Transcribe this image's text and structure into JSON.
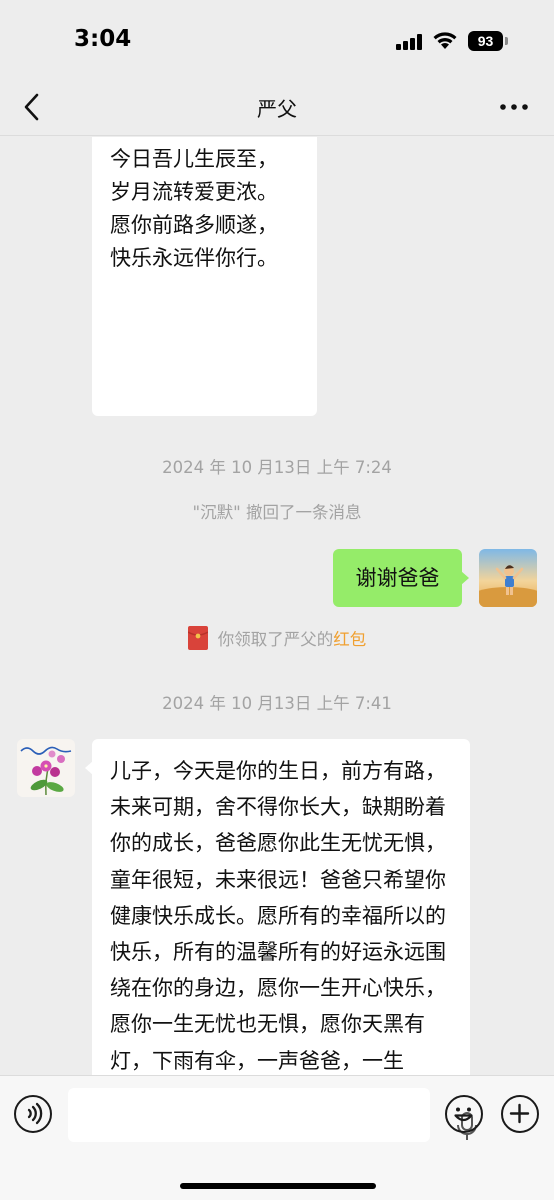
{
  "status_bar": {
    "time": "3:04",
    "battery": "93"
  },
  "nav": {
    "title": "严父",
    "back_icon": "chevron-left-icon",
    "more_icon": "more-dots-icon"
  },
  "messages": {
    "poem": "今日吾儿生辰至，\n岁月流转爱更浓。\n愿你前路多顺遂，\n快乐永远伴你行。",
    "timestamp_1": "2024 年 10 月13日 上午 7:24",
    "recall_notice": "\"沉默\" 撤回了一条消息",
    "reply": "谢谢爸爸",
    "redpacket_prefix": "你领取了严父的",
    "redpacket_link": "红包",
    "timestamp_2": "2024 年 10 月13日 上午 7:41",
    "long_message": "儿子，今天是你的生日，前方有路，未来可期，舍不得你长大，缺期盼着你的成长，爸爸愿你此生无忧无惧，童年很短，未来很远！爸爸只希望你健康快乐成长。愿所有的幸福所以的快乐，所有的温馨所有的好运永远围绕在你的身边，愿你一生开心快乐，愿你一生无忧也无惧，愿你天黑有灯，下雨有伞，一声爸爸，一生"
  },
  "input_bar": {
    "voice_icon": "voice-icon",
    "mic_icon": "mic-icon",
    "emoji_icon": "emoji-icon",
    "plus_icon": "plus-icon"
  },
  "colors": {
    "background": "#ededed",
    "self_bubble": "#95ec69",
    "other_bubble": "#ffffff",
    "redpacket_link": "#f0a030",
    "redpacket_icon": "#d9433a"
  }
}
